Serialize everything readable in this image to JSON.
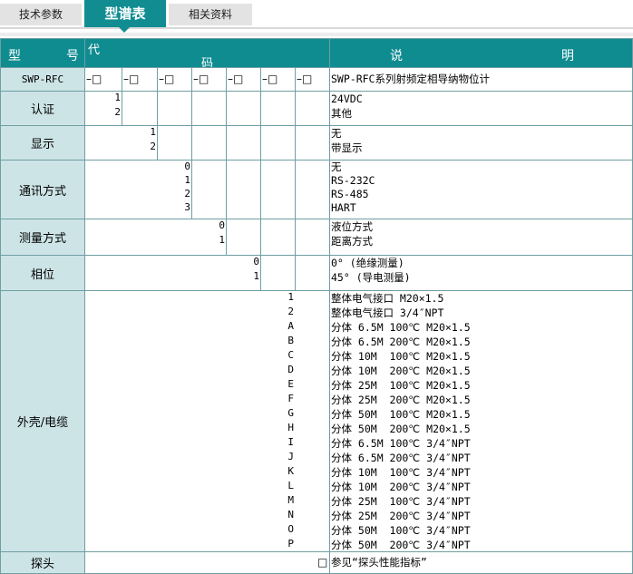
{
  "tabs": [
    {
      "label": "技术参数",
      "active": false
    },
    {
      "label": "型谱表",
      "active": true
    },
    {
      "label": "相关资料",
      "active": false
    }
  ],
  "header": {
    "model_1": "型",
    "model_2": "号",
    "code_1": "代",
    "code_2": "码",
    "desc_1": "说",
    "desc_2": "明"
  },
  "model_row": {
    "label": "SWP-RFC",
    "slot_symbol": "–□",
    "description": "SWP-RFC系列射频定相导纳物位计"
  },
  "rows": [
    {
      "label": "认证",
      "codes": [
        "1",
        "2"
      ],
      "descriptions": [
        "24VDC",
        "其他"
      ]
    },
    {
      "label": "显示",
      "codes": [
        "1",
        "2"
      ],
      "descriptions": [
        "无",
        "带显示"
      ]
    },
    {
      "label": "通讯方式",
      "codes": [
        "0",
        "1",
        "2",
        "3"
      ],
      "descriptions": [
        "无",
        "RS-232C",
        "RS-485",
        "HART"
      ]
    },
    {
      "label": "测量方式",
      "codes": [
        "0",
        "1"
      ],
      "descriptions": [
        "液位方式",
        "距离方式"
      ]
    },
    {
      "label": "相位",
      "codes": [
        "0",
        "1"
      ],
      "descriptions": [
        "0° (绝缘测量)",
        "45° (导电测量)"
      ]
    },
    {
      "label": "外壳/电缆",
      "codes": [
        "1",
        "2",
        "A",
        "B",
        "C",
        "D",
        "E",
        "F",
        "G",
        "H",
        "I",
        "J",
        "K",
        "L",
        "M",
        "N",
        "O",
        "P"
      ],
      "descriptions": [
        "整体电气接口 M20×1.5",
        "整体电气接口 3/4″NPT",
        "分体 6.5M 100℃ M20×1.5",
        "分体 6.5M 200℃ M20×1.5",
        "分体 10M  100℃ M20×1.5",
        "分体 10M  200℃ M20×1.5",
        "分体 25M  100℃ M20×1.5",
        "分体 25M  200℃ M20×1.5",
        "分体 50M  100℃ M20×1.5",
        "分体 50M  200℃ M20×1.5",
        "分体 6.5M 100℃ 3/4″NPT",
        "分体 6.5M 200℃ 3/4″NPT",
        "分体 10M  100℃ 3/4″NPT",
        "分体 10M  200℃ 3/4″NPT",
        "分体 25M  100℃ 3/4″NPT",
        "分体 25M  200℃ 3/4″NPT",
        "分体 50M  100℃ 3/4″NPT",
        "分体 50M  200℃ 3/4″NPT"
      ]
    },
    {
      "label": "探头",
      "codes": [
        "□"
      ],
      "descriptions": [
        "参见“探头性能指标”"
      ]
    }
  ],
  "colors": {
    "header_bg": "#0f8c90",
    "label_bg": "#cde4e6",
    "border": "#6f9ea3"
  }
}
